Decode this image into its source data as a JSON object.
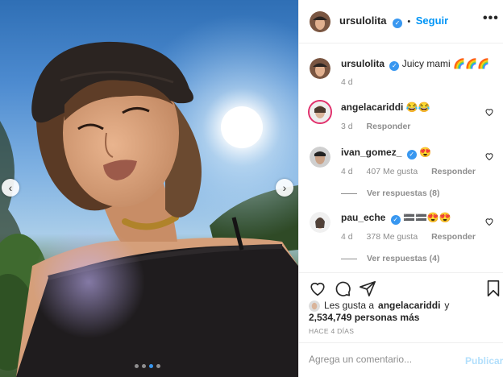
{
  "post": {
    "author": "ursulolita",
    "follow_label": "Seguir",
    "separator": "•",
    "more_glyph": "•••",
    "carousel": {
      "slide_count": 4,
      "active_slide": 3,
      "prev_glyph": "‹",
      "next_glyph": "›"
    }
  },
  "caption": {
    "user": "ursulolita",
    "text": "Juicy mami",
    "emoji": "🌈🌈🌈",
    "age": "4 d"
  },
  "comments": [
    {
      "user": "angelacariddi",
      "text": "😂😂",
      "age": "3 d",
      "likes": "",
      "reply_label": "Responder",
      "verified": false
    },
    {
      "user": "ivan_gomez_",
      "text": "😍",
      "age": "4 d",
      "likes": "407 Me gusta",
      "reply_label": "Responder",
      "verified": true,
      "view_replies": "Ver respuestas (8)"
    },
    {
      "user": "pau_eche",
      "text": "🟰🟰😍😍",
      "age": "4 d",
      "likes": "378 Me gusta",
      "reply_label": "Responder",
      "verified": true,
      "view_replies": "Ver respuestas (4)"
    }
  ],
  "likes": {
    "prefix": "Les gusta a",
    "first_user": "angelacariddi",
    "connector": "y",
    "others": "2,534,749 personas más"
  },
  "timestamp": "HACE 4 DÍAS",
  "composer": {
    "placeholder": "Agrega un comentario...",
    "publish_label": "Publicar"
  },
  "colors": {
    "accent": "#0095f6",
    "verified": "#3897f0",
    "muted": "#8e8e8e",
    "border": "#efefef"
  }
}
